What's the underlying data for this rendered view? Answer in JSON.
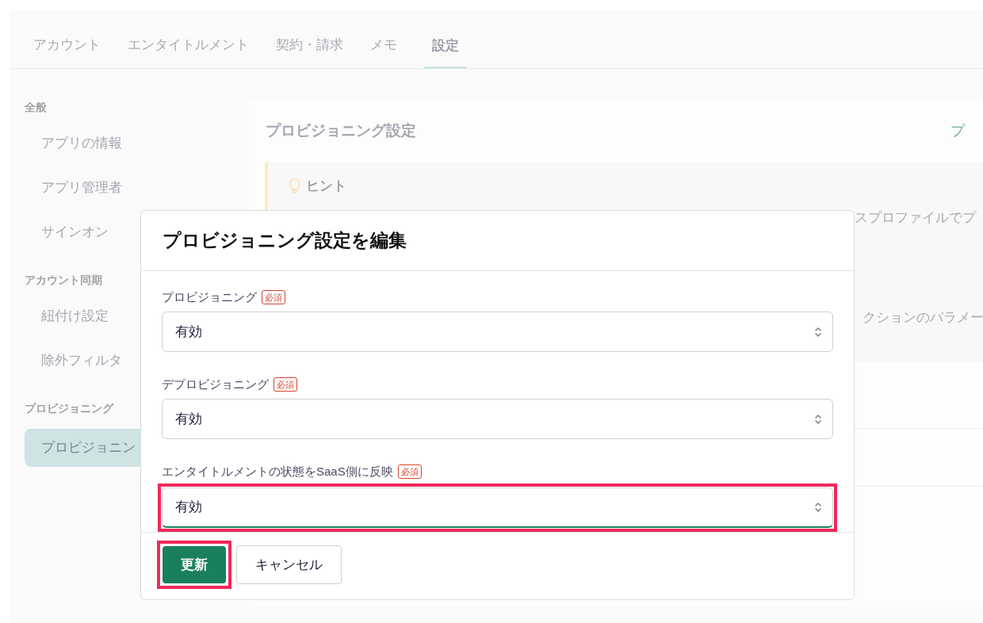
{
  "tabs": [
    {
      "label": "アカウント",
      "selected": false
    },
    {
      "label": "エンタイトルメント",
      "selected": false
    },
    {
      "label": "契約・請求",
      "selected": false
    },
    {
      "label": "メモ",
      "selected": false
    },
    {
      "label": "設定",
      "selected": true
    }
  ],
  "sidebar": {
    "sections": [
      {
        "title": "全般",
        "items": [
          {
            "label": "アプリの情報",
            "selected": false
          },
          {
            "label": "アプリ管理者",
            "selected": false
          },
          {
            "label": "サインオン",
            "selected": false
          }
        ]
      },
      {
        "title": "アカウント同期",
        "items": [
          {
            "label": "紐付け設定",
            "selected": false
          },
          {
            "label": "除外フィルタ",
            "selected": false
          }
        ]
      },
      {
        "title": "プロビジョニング",
        "items": [
          {
            "label": "プロビジョニン",
            "selected": true
          }
        ]
      }
    ]
  },
  "panel": {
    "title": "プロビジョニング設定",
    "header_link": "プ",
    "hint": {
      "title": "ヒント",
      "lines": [
        "スプロファイルでプ",
        "クションのパラメー"
      ]
    }
  },
  "dialog": {
    "title": "プロビジョニング設定を編集",
    "fields": [
      {
        "label": "プロビジョニング",
        "badge": "必須",
        "value": "有効",
        "highlighted": false
      },
      {
        "label": "デプロビジョニング",
        "badge": "必須",
        "value": "有効",
        "highlighted": false
      },
      {
        "label": "エンタイトルメントの状態をSaaS側に反映",
        "badge": "必須",
        "value": "有効",
        "highlighted": true
      }
    ],
    "buttons": [
      {
        "label": "更新",
        "kind": "primary",
        "highlighted": true
      },
      {
        "label": "キャンセル",
        "kind": "secondary",
        "highlighted": false
      }
    ]
  }
}
